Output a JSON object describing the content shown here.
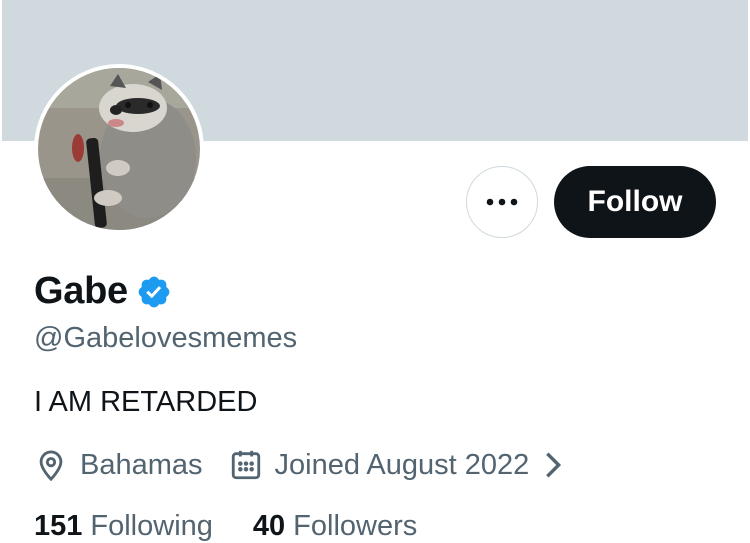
{
  "profile": {
    "name": "Gabe",
    "handle": "@Gabelovesmemes",
    "bio": "I AM RETARDED",
    "location": "Bahamas",
    "joined": "Joined August 2022"
  },
  "actions": {
    "follow_label": "Follow"
  },
  "stats": {
    "following_count": "151",
    "following_label": "Following",
    "followers_count": "40",
    "followers_label": "Followers"
  },
  "icons": {
    "verified": "verified-badge-icon",
    "location": "location-pin-icon",
    "calendar": "calendar-icon",
    "chevron": "chevron-right-icon",
    "more": "more-horizontal-icon"
  },
  "colors": {
    "banner": "#cfd9de",
    "follow_button": "#0f1419",
    "verified": "#1d9bf0",
    "secondary_text": "#536471"
  }
}
